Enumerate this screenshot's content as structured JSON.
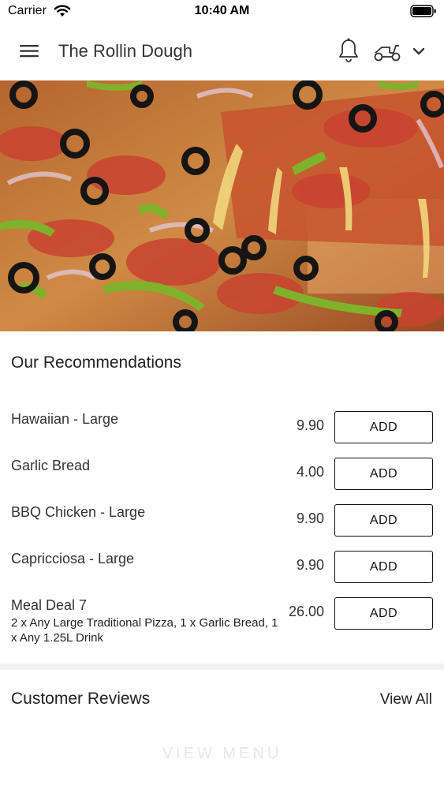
{
  "status_bar": {
    "carrier": "Carrier",
    "time": "10:40 AM"
  },
  "header": {
    "title": "The Rollin Dough",
    "icons": [
      "menu-icon",
      "bell-icon",
      "scooter-icon",
      "chevron-down-icon"
    ]
  },
  "hero": {
    "image": "pizza-photo"
  },
  "recommendations": {
    "title": "Our Recommendations",
    "add_label": "ADD",
    "items": [
      {
        "name": "Hawaiian - Large",
        "price": "9.90"
      },
      {
        "name": "Garlic Bread",
        "price": "4.00"
      },
      {
        "name": "BBQ Chicken - Large",
        "price": "9.90"
      },
      {
        "name": "Capricciosa - Large",
        "price": "9.90"
      },
      {
        "name": "Meal Deal 7",
        "description": "2 x Any Large Traditional Pizza, 1 x Garlic Bread, 1 x Any 1.25L Drink",
        "price": "26.00"
      }
    ]
  },
  "reviews": {
    "title": "Customer Reviews",
    "view_all": "View All"
  },
  "footer": {
    "view_menu": "VIEW MENU"
  }
}
